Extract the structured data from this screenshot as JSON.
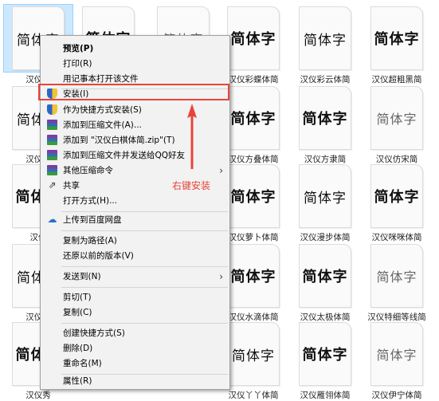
{
  "tiles": [
    {
      "preview": "简体字",
      "caption": "汉仪白"
    },
    {
      "preview": "简体字",
      "caption": ""
    },
    {
      "preview": "简体字",
      "caption": ""
    },
    {
      "preview": "简体字",
      "caption": "汉仪彩蝶体简"
    },
    {
      "preview": "简体字",
      "caption": "汉仪彩云体简"
    },
    {
      "preview": "简体字",
      "caption": "汉仪超粗黑简"
    },
    {
      "preview": "简体字",
      "caption": "汉仪黛"
    },
    {
      "preview": "简体字",
      "caption": "汉仪方叠体简"
    },
    {
      "preview": "简体字",
      "caption": "汉仪方隶简"
    },
    {
      "preview": "简体字",
      "caption": "汉仪仿宋简"
    },
    {
      "preview": "简体字",
      "caption": "汉仪"
    },
    {
      "preview": "简体字",
      "caption": "汉仪萝卜体简"
    },
    {
      "preview": "简体字",
      "caption": "汉仪漫步体简"
    },
    {
      "preview": "简体字",
      "caption": "汉仪咪咪体简"
    },
    {
      "preview": "简体字",
      "caption": "汉仪舒"
    },
    {
      "preview": "简体字",
      "caption": "汉仪水滴体简"
    },
    {
      "preview": "简体字",
      "caption": "汉仪太极体简"
    },
    {
      "preview": "简体字",
      "caption": "汉仪特细等线简"
    },
    {
      "preview": "简体字",
      "caption": "汉仪秀"
    },
    {
      "preview": "简体字",
      "caption": "汉仪丫丫体简"
    },
    {
      "preview": "简体字",
      "caption": "汉仪雁翎体简"
    },
    {
      "preview": "简体字",
      "caption": "汉仪伊宁体简"
    }
  ],
  "menu": {
    "items": [
      {
        "label": "预览(P)",
        "icon": ""
      },
      {
        "label": "打印(R)",
        "icon": ""
      },
      {
        "label": "用记事本打开该文件",
        "icon": ""
      },
      {
        "label": "安装(I)",
        "icon": "shield-icon"
      },
      {
        "label": "作为快捷方式安装(S)",
        "icon": "shield-icon"
      },
      {
        "label": "添加到压缩文件(A)...",
        "icon": "winrar-icon"
      },
      {
        "label": "添加到 \"汉仪白棋体简.zip\"(T)",
        "icon": "winrar-icon"
      },
      {
        "label": "添加到压缩文件并发送给QQ好友",
        "icon": "winrar-icon"
      },
      {
        "label": "其他压缩命令",
        "icon": "winrar-icon"
      },
      {
        "label": "共享",
        "icon": "share-icon"
      },
      {
        "label": "打开方式(H)...",
        "icon": ""
      },
      {
        "label": "上传到百度网盘",
        "icon": "cloud-icon"
      },
      {
        "label": "复制为路径(A)",
        "icon": ""
      },
      {
        "label": "还原以前的版本(V)",
        "icon": ""
      },
      {
        "label": "发送到(N)",
        "icon": ""
      },
      {
        "label": "剪切(T)",
        "icon": ""
      },
      {
        "label": "复制(C)",
        "icon": ""
      },
      {
        "label": "创建快捷方式(S)",
        "icon": ""
      },
      {
        "label": "删除(D)",
        "icon": ""
      },
      {
        "label": "重命名(M)",
        "icon": ""
      },
      {
        "label": "属性(R)",
        "icon": ""
      }
    ],
    "submenu_arrow": "›"
  },
  "annotation": {
    "text": "右键安装",
    "color": "#e8443a"
  },
  "colors": {
    "accent": "#e8443a",
    "menu_bg": "#f2f2f2",
    "selection": "#cce8ff"
  }
}
